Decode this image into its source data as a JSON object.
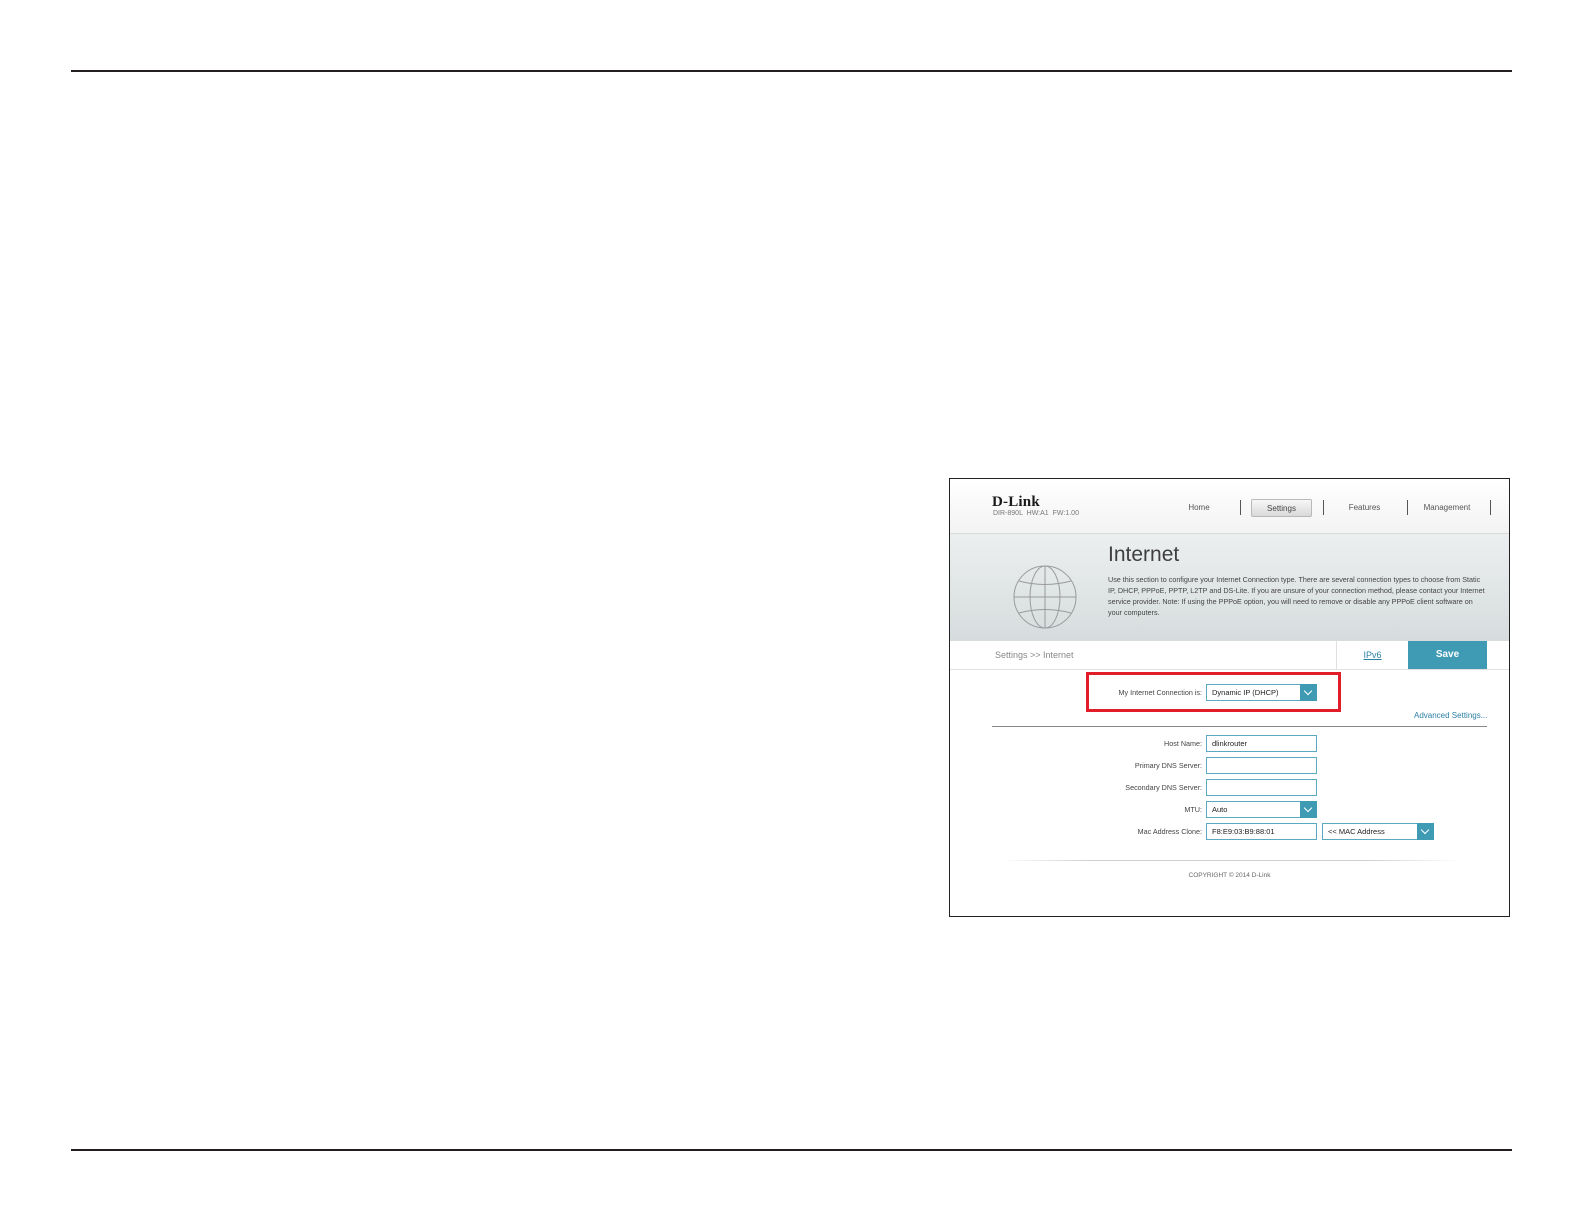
{
  "router_ui": {
    "brand": "D-Link",
    "model_info": "DIR-890L  HW:A1  FW:1.00",
    "nav": {
      "home": "Home",
      "settings": "Settings",
      "features": "Features",
      "management": "Management"
    },
    "banner": {
      "title": "Internet",
      "description": "Use this section to configure your Internet Connection type. There are several connection types to choose from Static IP, DHCP, PPPoE, PPTP, L2TP and DS-Lite. If you are unsure of your connection method, please contact your Internet service provider. Note: If using the PPPoE option, you will need to remove or disable any PPPoE client software on your computers."
    },
    "breadcrumb": "Settings >> Internet",
    "ipv6_link": "IPv6",
    "save_label": "Save",
    "connection": {
      "label": "My Internet Connection is:",
      "value": "Dynamic IP (DHCP)"
    },
    "advanced_link": "Advanced Settings...",
    "form": {
      "host_name_label": "Host Name:",
      "host_name_value": "dlinkrouter",
      "primary_dns_label": "Primary DNS Server:",
      "primary_dns_value": "",
      "secondary_dns_label": "Secondary DNS Server:",
      "secondary_dns_value": "",
      "mtu_label": "MTU:",
      "mtu_value": "Auto",
      "mac_clone_label": "Mac Address Clone:",
      "mac_clone_value": "F8:E9:03:B9:88:01",
      "mac_select_value": "<< MAC Address"
    },
    "copyright": "COPYRIGHT © 2014 D-Link"
  },
  "colors": {
    "accent": "#3f9bb3",
    "highlight": "#e11d2a",
    "link": "#2a7fa4"
  }
}
